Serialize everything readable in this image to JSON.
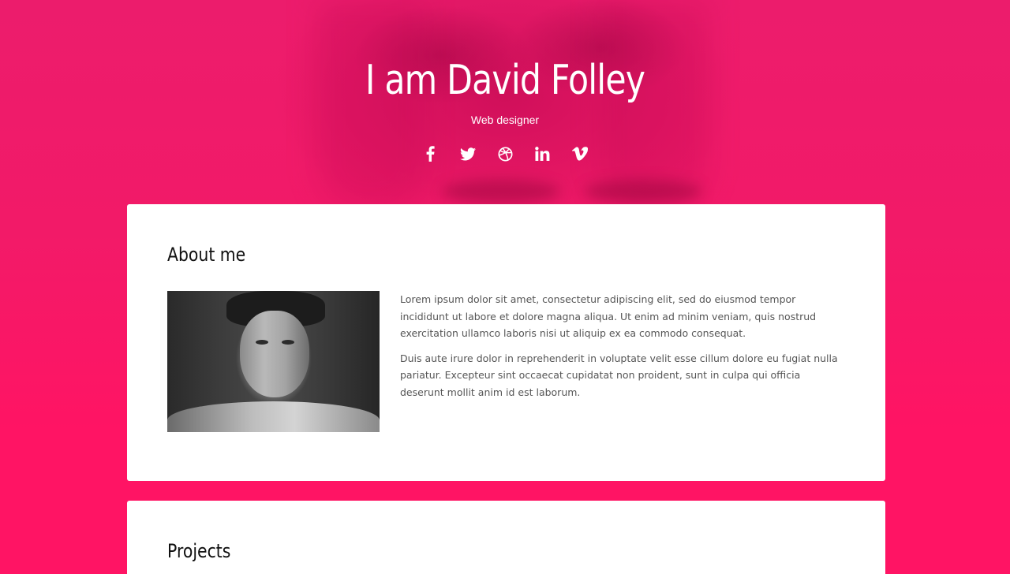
{
  "header": {
    "name": "I am David Folley",
    "role": "Web designer"
  },
  "socials": [
    {
      "icon": "facebook-icon"
    },
    {
      "icon": "twitter-icon"
    },
    {
      "icon": "dribbble-icon"
    },
    {
      "icon": "linkedin-icon"
    },
    {
      "icon": "vimeo-icon"
    }
  ],
  "about": {
    "title": "About me",
    "paragraphs": [
      "Lorem ipsum dolor sit amet, consectetur adipiscing elit, sed do eiusmod tempor incididunt ut labore et dolore magna aliqua. Ut enim ad minim veniam, quis nostrud exercitation ullamco laboris nisi ut aliquip ex ea commodo consequat.",
      "Duis aute irure dolor in reprehenderit in voluptate velit esse cillum dolore eu fugiat nulla pariatur. Excepteur sint occaecat cupidatat non proident, sunt in culpa qui officia deserunt mollit anim id est laborum."
    ]
  },
  "projects": {
    "title": "Projects"
  },
  "colors": {
    "accent": "#ff1464",
    "card": "#ffffff",
    "heading": "#111111",
    "body_text": "#555555"
  }
}
